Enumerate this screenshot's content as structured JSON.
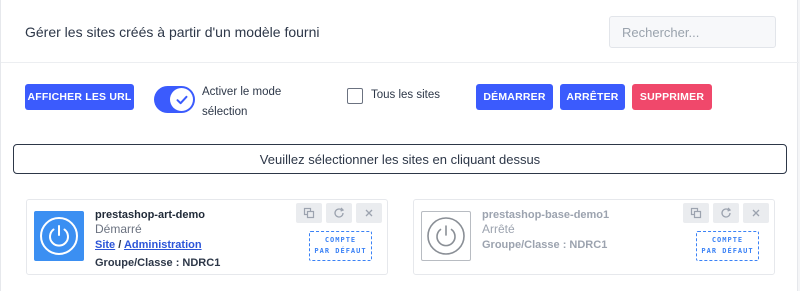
{
  "header": {
    "title": "Gérer les sites créés à partir d'un modèle fourni",
    "search_placeholder": "Rechercher..."
  },
  "toolbar": {
    "show_urls_label": "AFFICHER LES URL",
    "selection_mode_line1": "Activer le mode",
    "selection_mode_line2": "sélection",
    "selection_mode_on": true,
    "all_sites_label": "Tous les sites",
    "all_sites_checked": false,
    "start_label": "DÉMARRER",
    "stop_label": "ARRÊTER",
    "delete_label": "SUPPRIMER"
  },
  "notice": "Veuillez sélectionner les sites en cliquant dessus",
  "sites": [
    {
      "name": "prestashop-art-demo",
      "status": "Démarré",
      "running": true,
      "site_link": "Site",
      "separator": "/",
      "admin_link": "Administration",
      "group": "Groupe/Classe : NDRC1",
      "stamp_line1": "COMPTE",
      "stamp_line2": "PAR DÉFAUT"
    },
    {
      "name": "prestashop-base-demo1",
      "status": "Arrêté",
      "running": false,
      "group": "Groupe/Classe : NDRC1",
      "stamp_line1": "COMPTE",
      "stamp_line2": "PAR DÉFAUT"
    }
  ],
  "colors": {
    "primary": "#3b5bfd",
    "danger": "#f0486b",
    "running_icon": "#3b8ff2",
    "stamp": "#3b82f6"
  },
  "icons": {
    "card_actions": [
      "copy-icon",
      "refresh-icon",
      "close-icon"
    ],
    "site_icon": "power-icon",
    "toggle": "check-icon"
  }
}
